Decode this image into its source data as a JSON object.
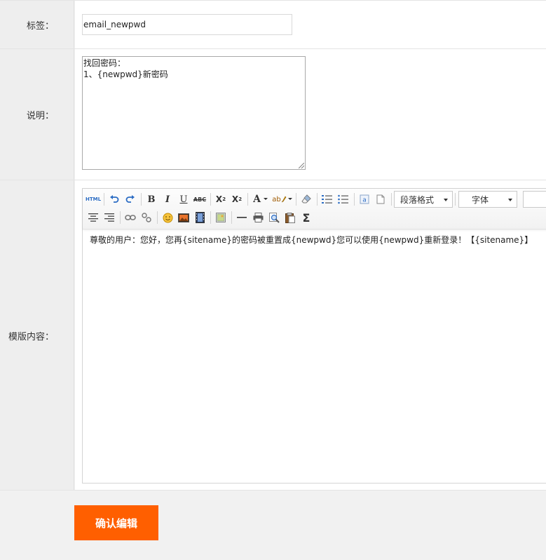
{
  "form": {
    "tag": {
      "label": "标签：",
      "value": "email_newpwd"
    },
    "description": {
      "label": "说明：",
      "value": "找回密码：\n1、{newpwd}新密码"
    },
    "template": {
      "label": "模版内容：",
      "content": "尊敬的用户：您好，您再{sitename}的密码被重置成{newpwd}您可以使用{newpwd}重新登录！【{sitename}】"
    }
  },
  "toolbar": {
    "html_label": "HTML",
    "bold": "B",
    "italic": "I",
    "underline": "U",
    "strike": "ABC",
    "superscript": "X",
    "sup_mark": "2",
    "subscript": "X",
    "sub_mark": "2",
    "font_color": "A",
    "highlight": "ab",
    "sigma": "Σ",
    "paragraph_select": "段落格式",
    "font_select": "字体"
  },
  "submit": {
    "label": "确认编辑"
  },
  "colors": {
    "accent": "#ff5f00",
    "undo_blue": "#2b6cc4"
  }
}
